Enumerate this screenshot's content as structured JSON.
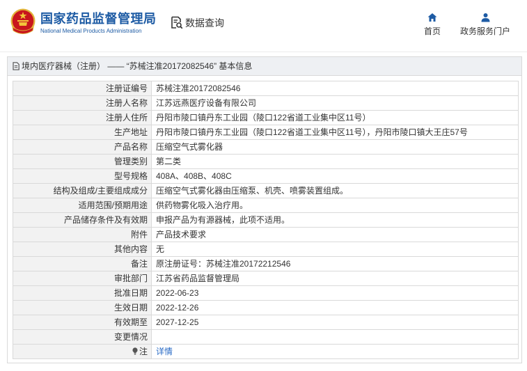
{
  "header": {
    "logo_icon": "nmpa-emblem-icon",
    "title": "国家药品监督管理局",
    "subtitle": "National Medical Products Administration",
    "query": {
      "icon": "document-search-icon",
      "label": "数据查询"
    },
    "nav": [
      {
        "icon": "home-icon",
        "label": "首页"
      },
      {
        "icon": "user-icon",
        "label": "政务服务门户"
      }
    ]
  },
  "breadcrumb": {
    "icon": "document-icon",
    "text": "境内医疗器械（注册） —— “苏械注准20172082546” 基本信息"
  },
  "table": {
    "rows": [
      {
        "label": "注册证编号",
        "value": "苏械注准20172082546"
      },
      {
        "label": "注册人名称",
        "value": "江苏远燕医疗设备有限公司"
      },
      {
        "label": "注册人住所",
        "value": "丹阳市陵口镇丹东工业园（陵口122省道工业集中区11号）"
      },
      {
        "label": "生产地址",
        "value": "丹阳市陵口镇丹东工业园（陵口122省道工业集中区11号），丹阳市陵口镇大王庄57号"
      },
      {
        "label": "产品名称",
        "value": "压缩空气式雾化器"
      },
      {
        "label": "管理类别",
        "value": "第二类"
      },
      {
        "label": "型号规格",
        "value": "408A、408B、408C"
      },
      {
        "label": "结构及组成/主要组成成分",
        "value": "压缩空气式雾化器由压缩泵、机壳、喷雾装置组成。"
      },
      {
        "label": "适用范围/预期用途",
        "value": "供药物雾化吸入治疗用。"
      },
      {
        "label": "产品储存条件及有效期",
        "value": "申报产品为有源器械，此项不适用。"
      },
      {
        "label": "附件",
        "value": "产品技术要求"
      },
      {
        "label": "其他内容",
        "value": "无"
      },
      {
        "label": "备注",
        "value": "原注册证号：苏械注准20172212546"
      },
      {
        "label": "审批部门",
        "value": "江苏省药品监督管理局"
      },
      {
        "label": "批准日期",
        "value": "2022-06-23"
      },
      {
        "label": "生效日期",
        "value": "2022-12-26"
      },
      {
        "label": "有效期至",
        "value": "2027-12-25"
      },
      {
        "label": "变更情况",
        "value": ""
      }
    ],
    "note": {
      "icon": "lightbulb-icon",
      "label": "注",
      "link": "详情"
    }
  },
  "colors": {
    "brand": "#1d5ba4",
    "link": "#2a6bc6",
    "label_bg": "#f2f2f2",
    "border": "#d9d9d9",
    "text": "#333333",
    "bar_bg": "#eef0f3"
  }
}
